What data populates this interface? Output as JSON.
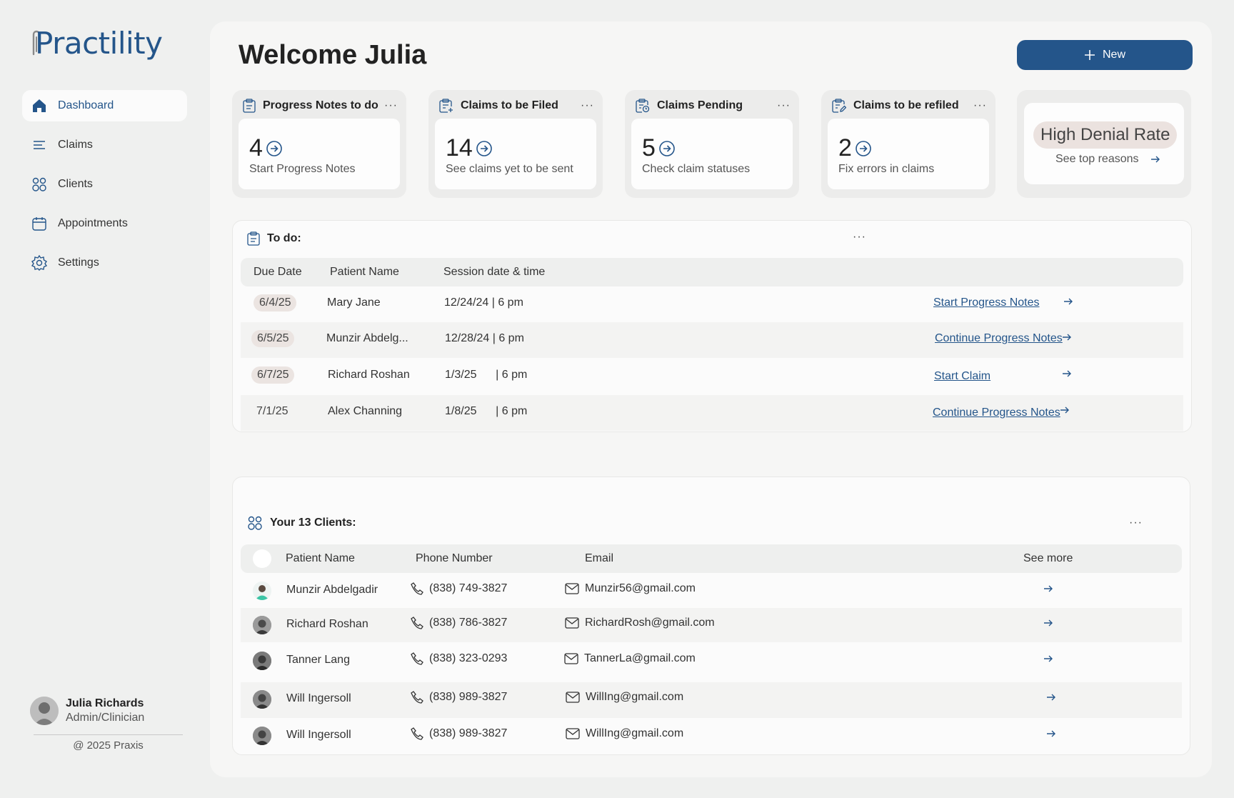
{
  "app": {
    "logo_text": "Practility"
  },
  "sidebar": {
    "items": [
      {
        "label": "Dashboard",
        "icon": "home-icon",
        "active": true
      },
      {
        "label": "Claims",
        "icon": "list-icon"
      },
      {
        "label": "Clients",
        "icon": "users-icon"
      },
      {
        "label": "Appointments",
        "icon": "calendar-icon"
      },
      {
        "label": "Settings",
        "icon": "gear-icon"
      }
    ],
    "profile": {
      "name": "Julia Richards",
      "role": "Admin/Clinician"
    },
    "copyright": "@ 2025 Praxis"
  },
  "header": {
    "welcome": "Welcome Julia",
    "new_label": "New"
  },
  "stats": [
    {
      "title": "Progress Notes to do",
      "value": "4",
      "subtitle": "Start Progress Notes",
      "icon": "clipboard-list-icon"
    },
    {
      "title": "Claims to be Filed",
      "value": "14",
      "subtitle": "See claims yet to be sent",
      "icon": "clipboard-plus-icon"
    },
    {
      "title": "Claims Pending",
      "value": "5",
      "subtitle": "Check claim statuses",
      "icon": "clipboard-clock-icon"
    },
    {
      "title": "Claims to be refiled",
      "value": "2",
      "subtitle": "Fix errors in claims",
      "icon": "clipboard-edit-icon"
    }
  ],
  "denial": {
    "label": "High Denial Rate",
    "sub": "See top reasons"
  },
  "todo": {
    "title": "To do:",
    "columns": [
      "Due Date",
      "Patient Name",
      "Session date & time"
    ],
    "rows": [
      {
        "due": "6/4/25",
        "patient": "Mary Jane",
        "session": "12/24/24 | 6 pm",
        "action": "Start Progress Notes",
        "pill": true
      },
      {
        "due": "6/5/25",
        "patient": "Munzir Abdelg...",
        "session": "12/28/24 | 6 pm",
        "action": "Continue Progress Notes",
        "pill": true
      },
      {
        "due": "6/7/25",
        "patient": "Richard Roshan",
        "session": "1/3/25      | 6 pm",
        "action": "Start Claim",
        "pill": true
      },
      {
        "due": "7/1/25",
        "patient": "Alex Channing",
        "session": "1/8/25      | 6 pm",
        "action": "Continue Progress Notes",
        "pill": false
      }
    ]
  },
  "clients": {
    "title": "Your 13 Clients:",
    "columns": [
      "Patient Name",
      "Phone Number",
      "Email",
      "See more"
    ],
    "rows": [
      {
        "name": "Munzir Abdelgadir",
        "phone": "(838) 749-3827",
        "email": "Munzir56@gmail.com"
      },
      {
        "name": "Richard Roshan",
        "phone": "(838) 786-3827",
        "email": "RichardRosh@gmail.com"
      },
      {
        "name": "Tanner Lang",
        "phone": "(838) 323-0293",
        "email": "TannerLa@gmail.com"
      },
      {
        "name": "Will Ingersoll",
        "phone": "(838) 989-3827",
        "email": "WillIng@gmail.com"
      },
      {
        "name": "Will Ingersoll",
        "phone": "(838) 989-3827",
        "email": "WillIng@gmail.com"
      }
    ]
  },
  "colors": {
    "accent": "#24558a",
    "background": "#eff0ef",
    "panel": "#f6f6f5",
    "pill": "#ebe4e1"
  }
}
